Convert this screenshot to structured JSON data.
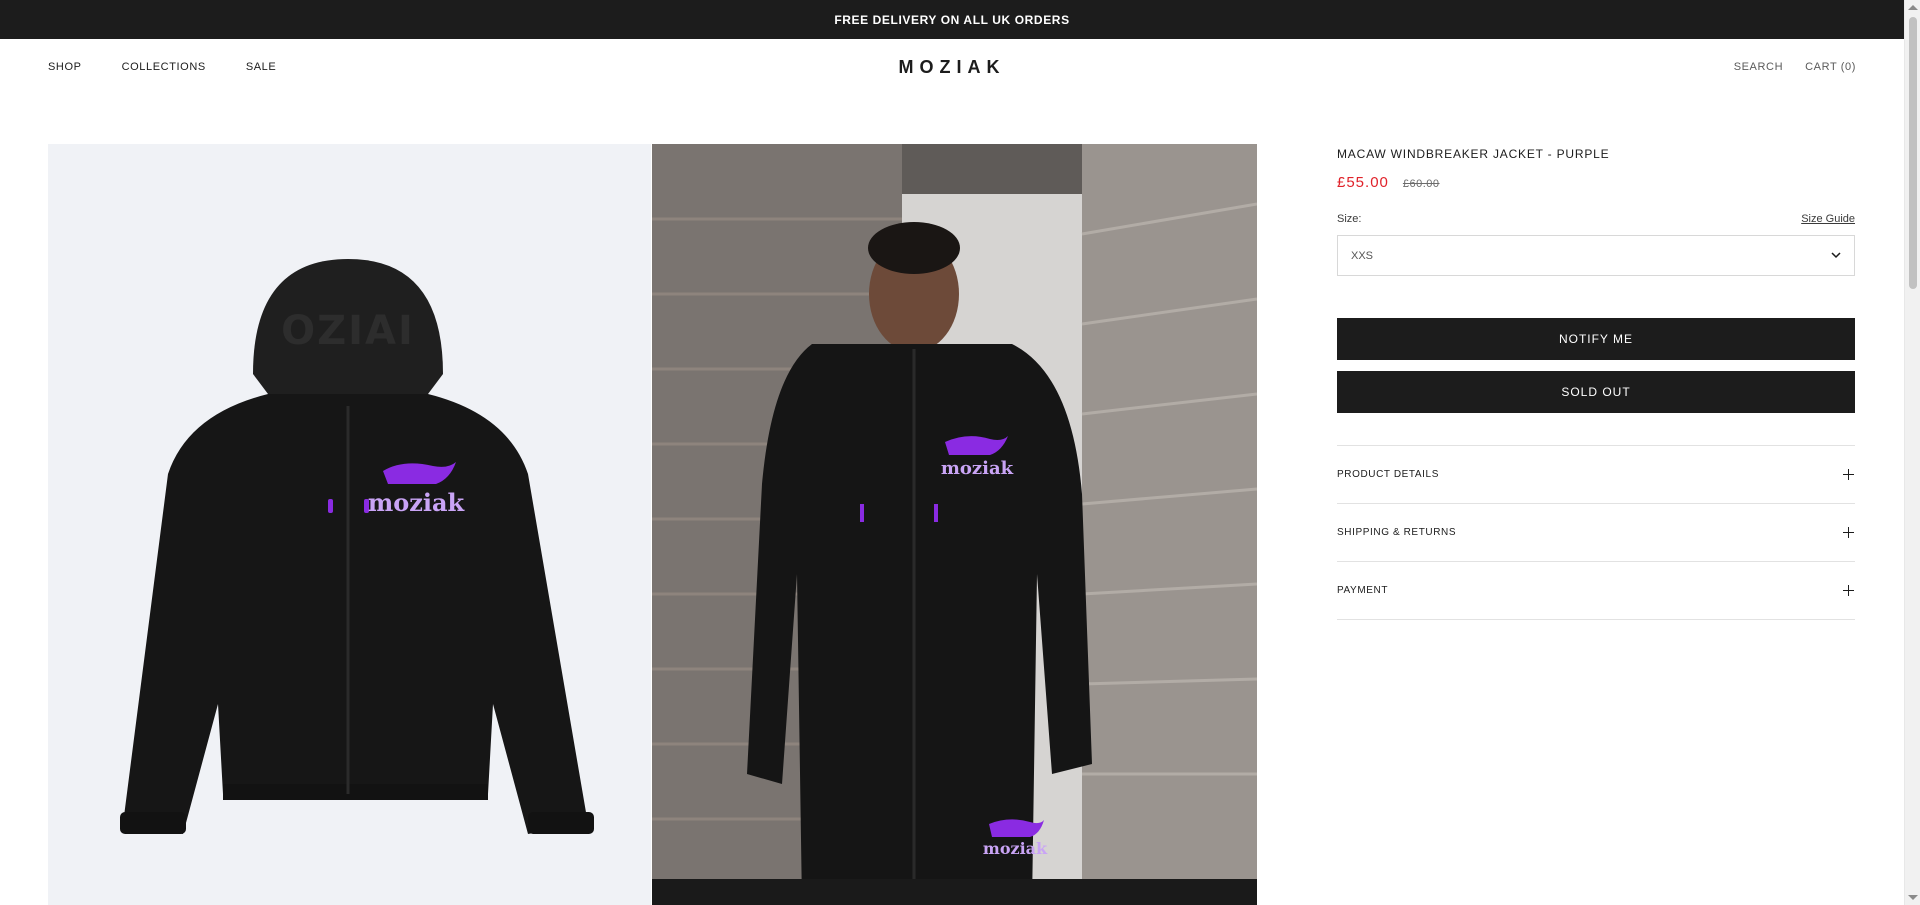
{
  "announcement": {
    "text": "FREE DELIVERY ON ALL UK ORDERS"
  },
  "header": {
    "nav_left": [
      {
        "label": "SHOP"
      },
      {
        "label": "COLLECTIONS"
      },
      {
        "label": "SALE"
      }
    ],
    "logo": "MOZIAK",
    "nav_right": {
      "search": "SEARCH",
      "cart": "CART (0)"
    }
  },
  "gallery": {
    "images": [
      {
        "description_icon": "jacket-flat-image"
      },
      {
        "description_icon": "model-photo-image"
      }
    ]
  },
  "product": {
    "title": "MACAW WINDBREAKER JACKET - PURPLE",
    "price_sale": "£55.00",
    "price_compare": "£60.00",
    "size_label": "Size:",
    "size_guide": "Size Guide",
    "size_selected": "XXS",
    "notify_button": "NOTIFY ME",
    "soldout_button": "SOLD OUT",
    "accordion": [
      {
        "label": "PRODUCT DETAILS"
      },
      {
        "label": "SHIPPING & RETURNS"
      },
      {
        "label": "PAYMENT"
      }
    ]
  },
  "colors": {
    "accent_price": "#e0222a",
    "dark": "#1c1c1c",
    "logo_purple": "#8a2be2"
  }
}
